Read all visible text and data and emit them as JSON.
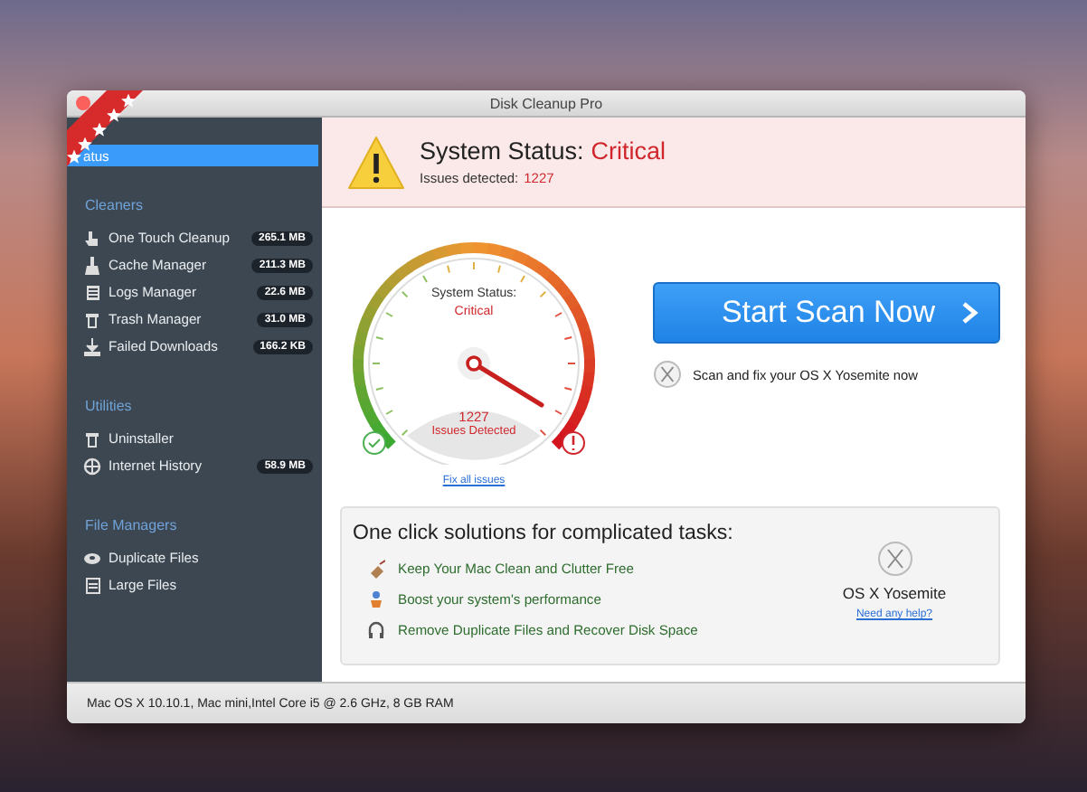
{
  "window": {
    "title": "Disk Cleanup Pro"
  },
  "sidebar": {
    "sections": [
      {
        "items": [
          {
            "label": "atus",
            "selected": true
          }
        ]
      },
      {
        "heading": "Cleaners",
        "items": [
          {
            "label": "One Touch Cleanup",
            "size": "265.1 MB",
            "selected": false
          },
          {
            "label": "Cache Manager",
            "size": "211.3 MB",
            "selected": false
          },
          {
            "label": "Logs Manager",
            "size": "22.6 MB",
            "selected": false
          },
          {
            "label": "Trash Manager",
            "size": "31.0 MB",
            "selected": false
          },
          {
            "label": "Failed Downloads",
            "size": "166.2 KB",
            "selected": false
          }
        ]
      },
      {
        "heading": "Utilities",
        "items": [
          {
            "label": "Uninstaller",
            "selected": false
          },
          {
            "label": "Internet History",
            "size": "58.9 MB",
            "selected": false
          }
        ]
      },
      {
        "heading": "File Managers",
        "items": [
          {
            "label": "Duplicate Files",
            "selected": false
          },
          {
            "label": "Large Files",
            "selected": false
          }
        ]
      }
    ]
  },
  "status_header": {
    "title": "System Status:",
    "status": "Critical",
    "issues_label": "Issues detected:",
    "issues_count": "1227"
  },
  "gauge": {
    "label": "System Status:",
    "status": "Critical",
    "count": "1227",
    "count_label": "Issues Detected",
    "link": "Fix all issues"
  },
  "scan": {
    "button": "Start Scan Now",
    "note": "Scan and fix your OS X Yosemite now"
  },
  "solutions": {
    "title": "One click solutions for complicated tasks:",
    "items": [
      "Keep Your Mac Clean and Clutter Free",
      "Boost your system's performance",
      "Remove Duplicate Files and Recover Disk Space"
    ],
    "os_name": "OS X Yosemite",
    "help_link": "Need any help?"
  },
  "status_bar": "Mac OS X 10.10.1, Mac mini,Intel Core i5 @ 2.6 GHz, 8 GB RAM"
}
